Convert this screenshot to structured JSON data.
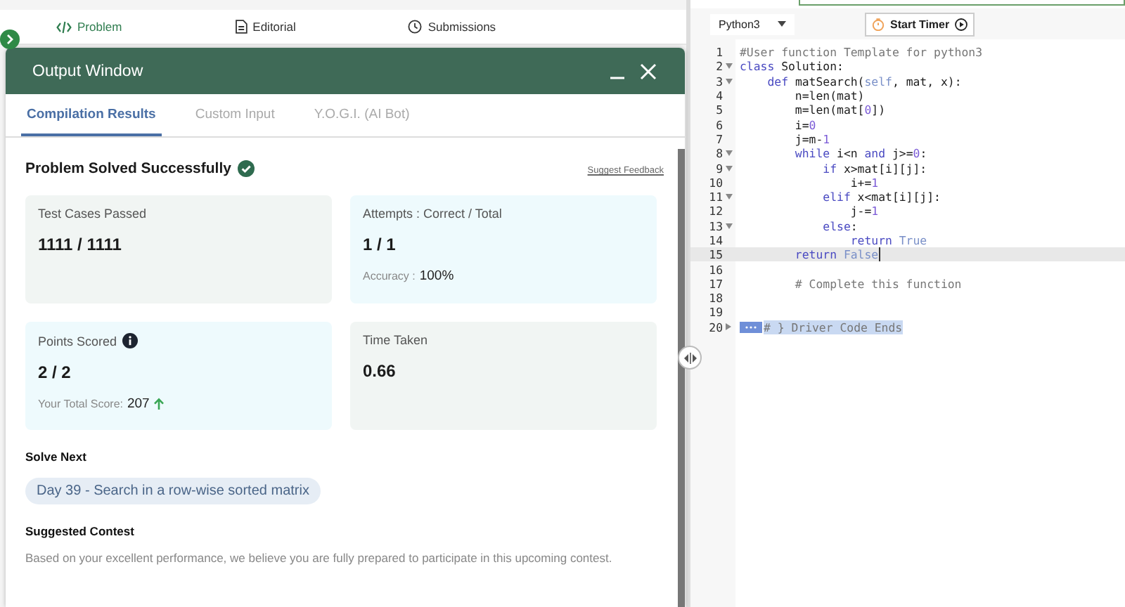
{
  "nav_tabs": [
    {
      "label": "Problem",
      "selected": true
    },
    {
      "label": "Editorial",
      "selected": false
    },
    {
      "label": "Submissions",
      "selected": false
    }
  ],
  "output_window": {
    "title": "Output Window",
    "tabs": [
      {
        "label": "Compilation Results",
        "selected": true
      },
      {
        "label": "Custom Input",
        "selected": false
      },
      {
        "label": "Y.O.G.I. (AI Bot)",
        "selected": false
      }
    ],
    "heading": "Problem Solved Successfully",
    "feedback_link": "Suggest Feedback",
    "cards": [
      {
        "label": "Test Cases Passed",
        "value": "1111 / 1111",
        "color": "#f1f5f3"
      },
      {
        "label": "Attempts : Correct / Total",
        "value": "1 / 1",
        "note_label": "Accuracy :",
        "note_value": "100%",
        "color": "#eefafd"
      },
      {
        "label": "Points Scored",
        "info": true,
        "value": "2 / 2",
        "note_label": "Your Total Score:",
        "note_value": "207",
        "trend_up": true,
        "color": "#eefafd"
      },
      {
        "label": "Time Taken",
        "value": "0.66",
        "color": "#f1f5f3"
      }
    ],
    "solve_next": {
      "heading": "Solve Next",
      "problem": "Day 39 - Search in a row-wise sorted matrix"
    },
    "suggested_contest": {
      "heading": "Suggested Contest",
      "text": "Based on your excellent performance, we believe you are fully prepared to participate in this upcoming contest."
    }
  },
  "editor": {
    "language": "Python3",
    "timer_button": "Start Timer",
    "lines": [
      {
        "number": "1",
        "tokens": [
          {
            "kind": "comment",
            "text": "#User function Template for python3"
          }
        ]
      },
      {
        "number": "2",
        "fold_open": true,
        "tokens": [
          {
            "kind": "keyword",
            "text": "class"
          },
          {
            "kind": "plain",
            "text": " Solution:"
          }
        ]
      },
      {
        "number": "3",
        "fold_open": true,
        "tokens": [
          {
            "kind": "keyword",
            "text": "    def"
          },
          {
            "kind": "plain",
            "text": " matSearch("
          },
          {
            "kind": "builtin",
            "text": "self"
          },
          {
            "kind": "plain",
            "text": ", mat, x):"
          }
        ]
      },
      {
        "number": "4",
        "tokens": [
          {
            "kind": "plain",
            "text": "        n=len(mat)"
          }
        ]
      },
      {
        "number": "5",
        "tokens": [
          {
            "kind": "plain",
            "text": "        m=len(mat["
          },
          {
            "kind": "number",
            "text": "0"
          },
          {
            "kind": "plain",
            "text": "])"
          }
        ]
      },
      {
        "number": "6",
        "tokens": [
          {
            "kind": "plain",
            "text": "        i="
          },
          {
            "kind": "number",
            "text": "0"
          }
        ]
      },
      {
        "number": "7",
        "tokens": [
          {
            "kind": "plain",
            "text": "        j=m-"
          },
          {
            "kind": "number",
            "text": "1"
          }
        ]
      },
      {
        "number": "8",
        "fold_open": true,
        "tokens": [
          {
            "kind": "keyword",
            "text": "        while"
          },
          {
            "kind": "plain",
            "text": " i<n "
          },
          {
            "kind": "keyword",
            "text": "and"
          },
          {
            "kind": "plain",
            "text": " j>="
          },
          {
            "kind": "number",
            "text": "0"
          },
          {
            "kind": "plain",
            "text": ":"
          }
        ]
      },
      {
        "number": "9",
        "fold_open": true,
        "tokens": [
          {
            "kind": "keyword",
            "text": "            if"
          },
          {
            "kind": "plain",
            "text": " x>mat[i][j]:"
          }
        ]
      },
      {
        "number": "10",
        "tokens": [
          {
            "kind": "plain",
            "text": "                i+="
          },
          {
            "kind": "number",
            "text": "1"
          }
        ]
      },
      {
        "number": "11",
        "fold_open": true,
        "tokens": [
          {
            "kind": "keyword",
            "text": "            elif"
          },
          {
            "kind": "plain",
            "text": " x<mat[i][j]:"
          }
        ]
      },
      {
        "number": "12",
        "tokens": [
          {
            "kind": "plain",
            "text": "                j-="
          },
          {
            "kind": "number",
            "text": "1"
          }
        ]
      },
      {
        "number": "13",
        "fold_open": true,
        "tokens": [
          {
            "kind": "keyword",
            "text": "            else"
          },
          {
            "kind": "plain",
            "text": ":"
          }
        ]
      },
      {
        "number": "14",
        "tokens": [
          {
            "kind": "keyword",
            "text": "                return"
          },
          {
            "kind": "builtin",
            "text": " True"
          }
        ]
      },
      {
        "number": "15",
        "active": true,
        "tokens": [
          {
            "kind": "keyword",
            "text": "        return"
          },
          {
            "kind": "builtin",
            "text": " False"
          }
        ]
      },
      {
        "number": "16"
      },
      {
        "number": "17",
        "tokens": [
          {
            "kind": "comment",
            "text": "        # Complete this function"
          }
        ]
      },
      {
        "number": "18"
      },
      {
        "number": "19"
      },
      {
        "number": "20",
        "fold_open": false,
        "selected": true,
        "tokens": [
          {
            "kind": "comment",
            "text": "# } Driver Code Ends"
          }
        ]
      }
    ]
  }
}
